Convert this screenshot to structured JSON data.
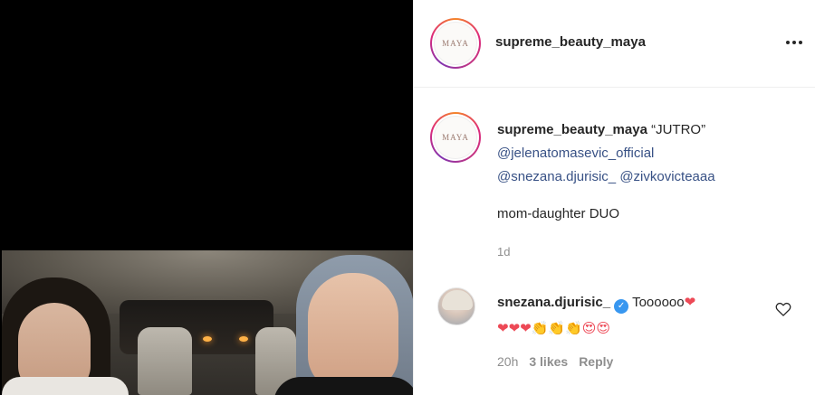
{
  "post": {
    "author": "supreme_beauty_maya",
    "avatar_text": "MAYA",
    "more_icon": "more-horizontal-icon"
  },
  "caption": {
    "author": "supreme_beauty_maya",
    "title": "“JUTRO”",
    "mentions": [
      "@jelenatomasevic_official",
      "@snezana.djurisic_",
      "@zivkovicteaaa"
    ],
    "body": "mom-daughter DUO",
    "time": "1d"
  },
  "comment": {
    "author": "snezana.djurisic_",
    "verified_icon": "verified-badge-icon",
    "verified_glyph": "✓",
    "text": "Toooooo",
    "emoji_first": "❤",
    "emoji_line": "❤❤❤👏👏👏😍😍",
    "time": "20h",
    "likes": "3 likes",
    "reply": "Reply",
    "like_icon": "heart-outline-icon"
  },
  "colors": {
    "mention": "#385185",
    "meta": "#8e8e8e",
    "verified": "#3897f0",
    "heart": "#ed4956"
  }
}
